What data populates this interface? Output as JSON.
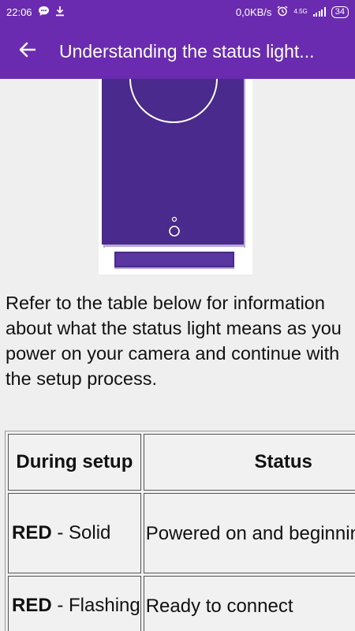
{
  "status_bar": {
    "time": "22:06",
    "speed": "0,0KB/s",
    "network_top": "4.5G",
    "network_bottom": "ill",
    "battery": "34",
    "icons": [
      "chat-notification-icon",
      "download-icon",
      "alarm-icon",
      "signal-icon",
      "battery-icon"
    ]
  },
  "app_bar": {
    "title": "Understanding the status light...",
    "back_icon": "arrow-left-icon"
  },
  "content": {
    "paragraph": "Refer to the table below for information about what the status light means as you power on your camera and continue with the setup process.",
    "illustration": "camera-illustration",
    "table": {
      "headers": [
        "During setup",
        "Status"
      ],
      "rows": [
        {
          "color": "RED",
          "mode": " - Solid",
          "status": "Powered on and beginning setup"
        },
        {
          "color": "RED",
          "mode": " - Flashing",
          "status": "Ready to connect"
        }
      ]
    }
  },
  "colors": {
    "primary": "#6a2bb0",
    "camera_body": "#4a2a8c",
    "background": "#efefef"
  }
}
